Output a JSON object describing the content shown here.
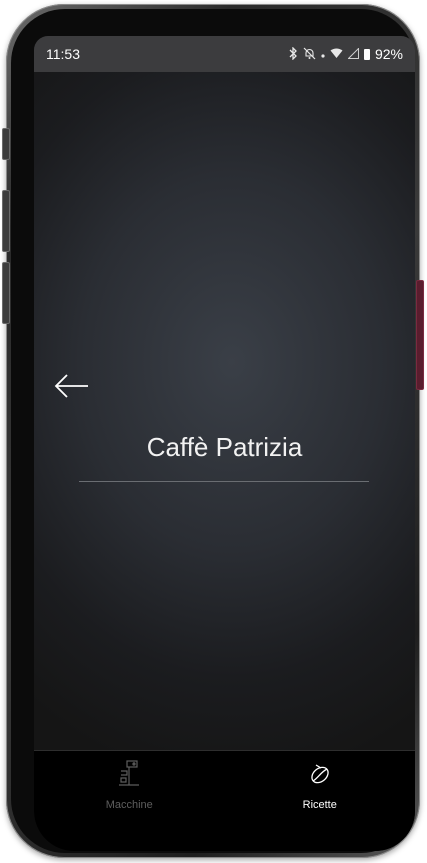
{
  "status_bar": {
    "time": "11:53",
    "bluetooth_icon": "bluetooth-icon",
    "mute_icon": "notifications-off-icon",
    "wifi_icon": "wifi-icon",
    "signal_icon": "signal-icon",
    "battery_icon": "battery-icon",
    "battery": "92%"
  },
  "header": {
    "back_icon": "arrow-left-icon",
    "title": "Caffè Patrizia"
  },
  "bottom_nav": {
    "items": [
      {
        "label": "Macchine",
        "icon": "coffee-machine-icon",
        "active": false
      },
      {
        "label": "Ricette",
        "icon": "coffee-bean-icon",
        "active": true
      }
    ]
  },
  "colors": {
    "background": "#1b1c1f",
    "nav_background": "#000000",
    "active_label": "#ffffff",
    "inactive_label": "#5e5e5e",
    "accent_side": "#5a1d2e"
  }
}
